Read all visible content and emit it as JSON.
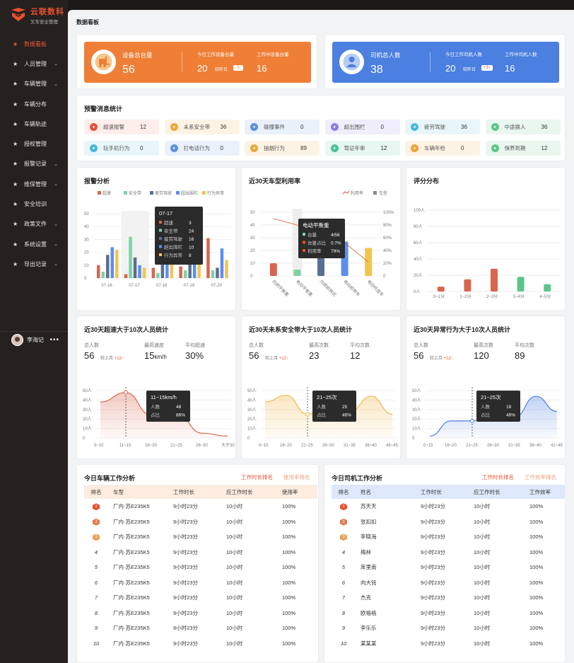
{
  "brand": {
    "name": "云联数科",
    "subtitle": "叉车安全管理"
  },
  "sidebar": {
    "items": [
      {
        "label": "数据看板",
        "icon": "star-icon",
        "active": true,
        "has_children": false
      },
      {
        "label": "人员管理",
        "icon": "star-icon",
        "active": false,
        "has_children": true
      },
      {
        "label": "车辆管理",
        "icon": "star-icon",
        "active": false,
        "has_children": true
      },
      {
        "label": "车辆分布",
        "icon": "star-icon",
        "active": false,
        "has_children": false
      },
      {
        "label": "车辆轨迹",
        "icon": "star-icon",
        "active": false,
        "has_children": false
      },
      {
        "label": "授权管理",
        "icon": "star-icon",
        "active": false,
        "has_children": false
      },
      {
        "label": "报警记录",
        "icon": "star-icon",
        "active": false,
        "has_children": true
      },
      {
        "label": "维保管理",
        "icon": "star-icon",
        "active": false,
        "has_children": true
      },
      {
        "label": "安全培训",
        "icon": "star-icon",
        "active": false,
        "has_children": false
      },
      {
        "label": "政策文件",
        "icon": "star-icon",
        "active": false,
        "has_children": true
      },
      {
        "label": "系统设置",
        "icon": "star-icon",
        "active": false,
        "has_children": true
      },
      {
        "label": "导出记录",
        "icon": "star-icon",
        "active": false,
        "has_children": true
      }
    ],
    "user": {
      "name": "李海记"
    }
  },
  "page": {
    "title": "数据看板"
  },
  "colors": {
    "orange": "#ef7f36",
    "blue": "#4b7fe0",
    "accent": "#e8502d",
    "active_menu": "#f05a35"
  },
  "device_banner": {
    "label": "设备总台量",
    "value": "56",
    "today_label": "今日工作设备台量",
    "today_value": "20",
    "compare_label": "较昨日",
    "compare_value": "-3",
    "compare_dir": "down",
    "working_label": "工作中设备台量",
    "working_value": "16"
  },
  "driver_banner": {
    "label": "司机总人数",
    "value": "38",
    "today_label": "今日工作司机人数",
    "today_value": "20",
    "compare_label": "较昨日",
    "compare_value": "+3",
    "compare_dir": "up",
    "working_label": "工作中司机人数",
    "working_value": "16"
  },
  "alerts": {
    "title": "预警消息统计",
    "items": [
      {
        "label": "超速报警",
        "value": "12",
        "color": "#e8503c",
        "bg": "#fdeeec"
      },
      {
        "label": "未系安全带",
        "value": "36",
        "color": "#e9a93c",
        "bg": "#fdf3e4"
      },
      {
        "label": "碰撞事件",
        "value": "0",
        "color": "#5f8fde",
        "bg": "#eaf1fc"
      },
      {
        "label": "超出围栏",
        "value": "0",
        "color": "#8d7ee2",
        "bg": "#f0eefc"
      },
      {
        "label": "疲劳驾驶",
        "value": "36",
        "color": "#49b9d8",
        "bg": "#e8f6fb"
      },
      {
        "label": "中途换人",
        "value": "36",
        "color": "#5cc68a",
        "bg": "#e9f7ef"
      },
      {
        "label": "玩手机行为",
        "value": "0",
        "color": "#49b9d8",
        "bg": "#e8f6fb"
      },
      {
        "label": "打电话行为",
        "value": "0",
        "color": "#5f8fde",
        "bg": "#eaf1fc"
      },
      {
        "label": "抽烟行为",
        "value": "89",
        "color": "#e9a93c",
        "bg": "#fdf3e4"
      },
      {
        "label": "驾证年审",
        "value": "12",
        "color": "#4cc29a",
        "bg": "#e7f7f1"
      },
      {
        "label": "车辆年检",
        "value": "0",
        "color": "#f0a23a",
        "bg": "#fdf3e4"
      },
      {
        "label": "保养到期",
        "value": "12",
        "color": "#5cc68a",
        "bg": "#e9f7ef"
      }
    ]
  },
  "alarm_chart": {
    "title": "报警分析",
    "chart_data": {
      "type": "bar",
      "categories": [
        "07-16",
        "07-17",
        "07-18",
        "07-19",
        "07-20"
      ],
      "series": [
        {
          "name": "超速",
          "color": "#d9654f",
          "values": [
            10,
            3,
            8,
            9,
            31
          ]
        },
        {
          "name": "安全带",
          "color": "#7fd2a5",
          "values": [
            5,
            32,
            4,
            6,
            6
          ]
        },
        {
          "name": "疲劳驾驶",
          "color": "#5a6e8f",
          "values": [
            18,
            16,
            30,
            14,
            8
          ]
        },
        {
          "name": "超出围栏",
          "color": "#5c8ef2",
          "values": [
            24,
            10,
            26,
            25,
            23
          ]
        },
        {
          "name": "行为异常",
          "color": "#f2c550",
          "values": [
            22,
            8,
            27,
            24,
            14
          ]
        }
      ],
      "ylim": [
        0,
        50
      ],
      "yticks": [
        0,
        10,
        20,
        30,
        40,
        50
      ]
    },
    "tooltip": {
      "title": "07-17",
      "rows": [
        {
          "name": "超速",
          "value": "3"
        },
        {
          "name": "安全带",
          "value": "24"
        },
        {
          "name": "疲劳驾驶",
          "value": "16"
        },
        {
          "name": "超出围栏",
          "value": "10"
        },
        {
          "name": "行为异常",
          "value": "8"
        }
      ]
    }
  },
  "util_chart": {
    "title": "近30天车型利用率",
    "legend_line": "利用率",
    "legend_bar": "车型",
    "chart_data": {
      "type": "bar",
      "categories": [
        "内燃平衡重",
        "电动平衡重",
        "内燃前移式",
        "电动前移车",
        "电动托盘车"
      ],
      "values": [
        10,
        5,
        44,
        27,
        22
      ],
      "rate": [
        90,
        80,
        48,
        52,
        22
      ],
      "ylim": [
        0,
        50
      ],
      "yticks": [
        0,
        10,
        20,
        30,
        40,
        50
      ],
      "y2ticks": [
        "0",
        "20%",
        "40%",
        "60%",
        "80%",
        "100%"
      ],
      "colors": [
        "#d9654f",
        "#7fd2a5",
        "#5a6e8f",
        "#5c8ef2",
        "#f2c550"
      ]
    },
    "tooltip": {
      "title": "电动平衡重",
      "rows": [
        {
          "name": "台量",
          "value": "4/56"
        },
        {
          "name": "台量占比",
          "value": "0.7%"
        },
        {
          "name": "利用率",
          "value": "79%"
        }
      ]
    }
  },
  "score_chart": {
    "title": "评分分布",
    "chart_data": {
      "type": "bar",
      "categories": [
        "0~1分",
        "1~2分",
        "2~3分",
        "3~4分",
        "4~5分"
      ],
      "values": [
        6,
        15,
        28,
        18,
        9
      ],
      "ylim": [
        0,
        100
      ],
      "yticks": [
        "0人",
        "20人",
        "40人",
        "60人",
        "80人",
        "100人"
      ],
      "colors": [
        "#d9654f",
        "#d9654f",
        "#d9654f",
        "#5cc68a",
        "#5cc68a"
      ]
    }
  },
  "speed_stats": {
    "title": "近30天超速大于10次人员统计",
    "total_label": "总人数",
    "total_value": "56",
    "cmp_label": "较上月",
    "cmp_value": "+12",
    "max_label": "最高速度",
    "max_value": "15",
    "max_unit": "km/h",
    "avg_label": "平均超速",
    "avg_value": "30%",
    "chart_data": {
      "type": "area",
      "categories": [
        "5~10",
        "11~15",
        "16~20",
        "21~25",
        "26~30",
        "大于30"
      ],
      "values": [
        38,
        48,
        24,
        25,
        5,
        2
      ],
      "yticks": [
        "0",
        "10人",
        "20人",
        "30人",
        "40人",
        "50人"
      ],
      "color": "#d9654f"
    },
    "tooltip": {
      "title": "11~15km/h",
      "rows": [
        {
          "name": "人数",
          "value": "48"
        },
        {
          "name": "占比",
          "value": "86%"
        }
      ]
    }
  },
  "belt_stats": {
    "title": "近30天未系安全带大于10次人员统计",
    "total_label": "总人数",
    "total_value": "56",
    "cmp_label": "较上月",
    "cmp_value": "+12",
    "max_label": "最高次数",
    "max_value": "23",
    "avg_label": "平均次数",
    "avg_value": "12",
    "chart_data": {
      "type": "area",
      "categories": [
        "0~15",
        "16~20",
        "21~25",
        "26~30",
        "31~35",
        "36~40",
        "46~45"
      ],
      "values": [
        38,
        45,
        25,
        35,
        28,
        44,
        25
      ],
      "yticks": [
        "0",
        "10人",
        "20人",
        "30人",
        "40人",
        "50人"
      ],
      "color": "#f0b84e"
    },
    "tooltip": {
      "title": "21~25次",
      "rows": [
        {
          "name": "人数",
          "value": "25"
        },
        {
          "name": "占比",
          "value": "46%"
        }
      ]
    }
  },
  "behavior_stats": {
    "title": "近30天异常行为大于10次人员统计",
    "total_label": "总人数",
    "total_value": "56",
    "cmp_label": "较上月",
    "cmp_value": "+12",
    "max_label": "最高次数",
    "max_value": "120",
    "avg_label": "平均次数",
    "avg_value": "89",
    "chart_data": {
      "type": "area",
      "categories": [
        "0~15",
        "16~20",
        "21~25",
        "26~30",
        "31~35",
        "36~40",
        "41~45"
      ],
      "values": [
        2,
        18,
        18,
        25,
        22,
        44,
        28
      ],
      "yticks": [
        "0",
        "10人",
        "20人",
        "30人",
        "40人",
        "50人"
      ],
      "color": "#4b7fe0"
    },
    "tooltip": {
      "title": "21~25次",
      "rows": [
        {
          "name": "人数",
          "value": "18"
        },
        {
          "name": "占比",
          "value": "46%"
        }
      ]
    }
  },
  "vehicle_table": {
    "title": "今日车辆工作分析",
    "tab1": "工作时长排名",
    "tab2": "使用率排名",
    "headers": [
      "排名",
      "车型",
      "工作时长",
      "应工作时长",
      "使用率"
    ],
    "rows": [
      {
        "rank": "1",
        "name": "厂内·苏E235K5",
        "hours": "9小时23分",
        "plan": "10小时",
        "rate": "100%"
      },
      {
        "rank": "2",
        "name": "厂内·苏E235K5",
        "hours": "9小时23分",
        "plan": "10小时",
        "rate": "100%"
      },
      {
        "rank": "3",
        "name": "厂内·苏E235K5",
        "hours": "9小时23分",
        "plan": "10小时",
        "rate": "100%"
      },
      {
        "rank": "4",
        "name": "厂内·苏E235K5",
        "hours": "9小时23分",
        "plan": "10小时",
        "rate": "100%"
      },
      {
        "rank": "5",
        "name": "厂内·苏E235K5",
        "hours": "9小时23分",
        "plan": "10小时",
        "rate": "100%"
      },
      {
        "rank": "6",
        "name": "厂内·苏E235K5",
        "hours": "9小时23分",
        "plan": "10小时",
        "rate": "100%"
      },
      {
        "rank": "7",
        "name": "厂内·苏E235K5",
        "hours": "9小时23分",
        "plan": "10小时",
        "rate": "100%"
      },
      {
        "rank": "8",
        "name": "厂内·苏E235K5",
        "hours": "9小时23分",
        "plan": "10小时",
        "rate": "100%"
      },
      {
        "rank": "9",
        "name": "厂内·苏E235K5",
        "hours": "9小时23分",
        "plan": "10小时",
        "rate": "100%"
      },
      {
        "rank": "10",
        "name": "厂内·苏E235K5",
        "hours": "9小时23分",
        "plan": "10小时",
        "rate": "100%"
      }
    ]
  },
  "driver_table": {
    "title": "今日司机工作分析",
    "tab1": "工作时长排名",
    "tab2": "工作效率排名",
    "headers": [
      "排名",
      "姓名",
      "工作时长",
      "应工作时长",
      "工作效率"
    ],
    "rows": [
      {
        "rank": "1",
        "name": "苏天天",
        "hours": "9小时23分",
        "plan": "10小时",
        "rate": "100%"
      },
      {
        "rank": "2",
        "name": "张扣扣",
        "hours": "9小时23分",
        "plan": "10小时",
        "rate": "100%"
      },
      {
        "rank": "3",
        "name": "李晓海",
        "hours": "9小时23分",
        "plan": "10小时",
        "rate": "100%"
      },
      {
        "rank": "4",
        "name": "梅林",
        "hours": "9小时23分",
        "plan": "10小时",
        "rate": "100%"
      },
      {
        "rank": "5",
        "name": "库里南",
        "hours": "9小时23分",
        "plan": "10小时",
        "rate": "100%"
      },
      {
        "rank": "6",
        "name": "向大铭",
        "hours": "9小时23分",
        "plan": "10小时",
        "rate": "100%"
      },
      {
        "rank": "7",
        "name": "杰克",
        "hours": "9小时23分",
        "plan": "10小时",
        "rate": "100%"
      },
      {
        "rank": "8",
        "name": "欧格格",
        "hours": "9小时23分",
        "plan": "10小时",
        "rate": "100%"
      },
      {
        "rank": "9",
        "name": "李乐乐",
        "hours": "9小时23分",
        "plan": "10小时",
        "rate": "100%"
      },
      {
        "rank": "10",
        "name": "某某某",
        "hours": "9小时23分",
        "plan": "10小时",
        "rate": "100%"
      }
    ]
  }
}
